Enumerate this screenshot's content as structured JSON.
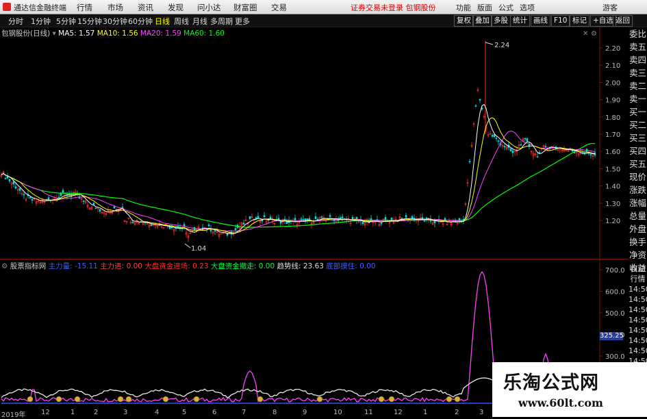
{
  "titlebar": {
    "app_name": "通达信金融终端",
    "menus": [
      "行情",
      "市场",
      "资讯",
      "发现",
      "问小达",
      "财富圈",
      "交易"
    ],
    "notice": "证券交易未登录  包钢股份",
    "right_items": [
      "功能",
      "版面",
      "公式",
      "选项",
      "游客"
    ]
  },
  "toolbar": {
    "periods": [
      "分时",
      "1分钟",
      "5分钟",
      "15分钟",
      "30分钟",
      "60分钟",
      "日线",
      "周线",
      "月线",
      "多周期",
      "更多"
    ],
    "active_period": "日线",
    "buttons": [
      "复权",
      "叠加",
      "多股",
      "统计",
      "画线",
      "F10",
      "标记",
      "+自选",
      "返回"
    ]
  },
  "main_chart": {
    "stock_label": "包钢股份(日线)",
    "ma": [
      {
        "label": "MA5: 1.57",
        "color": "#ffffff"
      },
      {
        "label": "MA10: 1.56",
        "color": "#ffff00"
      },
      {
        "label": "MA20: 1.59",
        "color": "#ff40ff"
      },
      {
        "label": "MA60: 1.60",
        "color": "#00ff00"
      }
    ],
    "price_ticks": [
      "2.20",
      "2.10",
      "2.00",
      "1.90",
      "1.80",
      "1.70",
      "1.60",
      "1.50",
      "1.40",
      "1.30",
      "1.20"
    ],
    "high_label": "2.24",
    "low_label": "1.04"
  },
  "sub_chart": {
    "title": "股票指标网",
    "indicators": [
      {
        "label": "主力量: -15.11",
        "color": "#4060ff"
      },
      {
        "label": "主力进: 0.00",
        "color": "#ff4040"
      },
      {
        "label": "大盘资金进场: 0.23",
        "color": "#ff3030"
      },
      {
        "label": "大盘资金撤走: 0.00",
        "color": "#00ff40"
      },
      {
        "label": "趋势线: 23.63",
        "color": "#dddddd"
      },
      {
        "label": "底部摸住: 0.00",
        "color": "#4060ff"
      }
    ],
    "axis_ticks": [
      "700.0",
      "600.0",
      "500.0",
      "400.0",
      "300.0"
    ],
    "highlight": "325.25"
  },
  "side_panel": {
    "items": [
      "委比",
      "卖五",
      "卖四",
      "卖三",
      "卖二",
      "卖一",
      "买一",
      "买二",
      "买三",
      "买四",
      "买五",
      "现价",
      "涨跌",
      "涨幅",
      "总量",
      "外盘",
      "换手",
      "净资",
      "收益"
    ],
    "sub_items": [
      "自动",
      "行情",
      "14:50",
      "14:50",
      "14:50",
      "14:50",
      "14:50",
      "14:50",
      "14:50",
      "14:50",
      "14:50",
      "14:50"
    ]
  },
  "date_axis": {
    "labels": [
      "2019年",
      "12",
      "1",
      "2",
      "3",
      "4",
      "5",
      "6",
      "7",
      "8",
      "9",
      "10",
      "11",
      "12",
      "1",
      "2",
      "3"
    ]
  },
  "watermark": {
    "title": "乐淘公式网",
    "url": "www.60lt.com"
  }
}
